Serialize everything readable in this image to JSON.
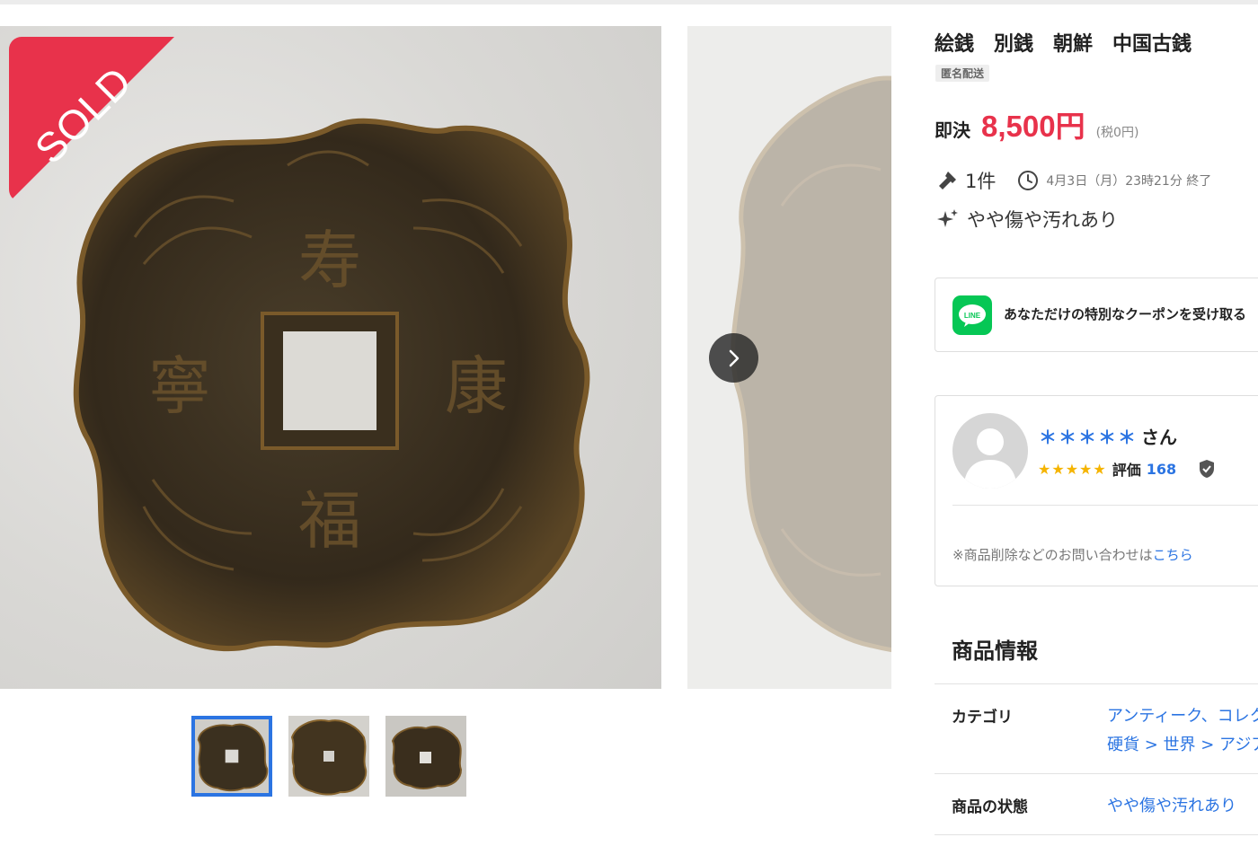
{
  "product": {
    "title": "絵銭　別銭　朝鮮　中国古銭",
    "shipping_tag": "匿名配送",
    "price_label": "即決",
    "price": "8,500円",
    "tax_note": "(税0円)",
    "status_ribbon": "SOLD"
  },
  "auction": {
    "bids": "1件",
    "end_time": "4月3日（月）23時21分 終了",
    "condition": "やや傷や汚れあり"
  },
  "line_banner": {
    "logo_text": "LINE",
    "text": "あなただけの特別なクーポンを受け取る"
  },
  "seller": {
    "name_masked": "＊＊＊＊＊",
    "name_suffix": "さん",
    "rating_stars": 5,
    "rating_label": "評価",
    "rating_count": "168",
    "report_prefix": "※商品削除などのお問い合わせは",
    "report_link": "こちら"
  },
  "info": {
    "heading": "商品情報",
    "rows": [
      {
        "label": "カテゴリ",
        "value_line1": "アンティーク、コレクション",
        "value_line2": "硬貨 > 世界 > アジア"
      },
      {
        "label": "商品の状態",
        "value_line1": "やや傷や汚れあり"
      }
    ]
  },
  "gallery": {
    "thumbnail_count": 3,
    "active_index": 0
  },
  "icons": {
    "next": "chevron-right-icon",
    "bids": "gavel-icon",
    "clock": "clock-icon",
    "condition": "sparkle-icon",
    "verified": "shield-check-icon"
  },
  "colors": {
    "accent_red": "#e8324b",
    "link_blue": "#2b74e2",
    "line_green": "#06c755",
    "star_gold": "#f5b400"
  }
}
